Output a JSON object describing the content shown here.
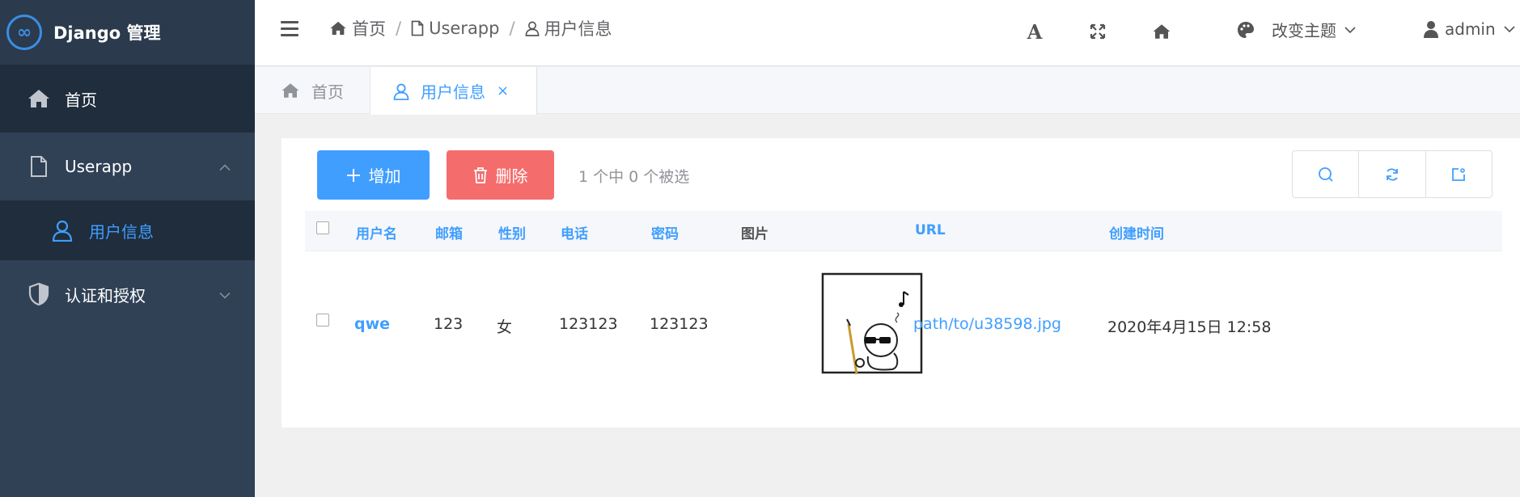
{
  "app": {
    "title": "Django 管理",
    "logo_glyph": "∞"
  },
  "sidebar": {
    "items": [
      {
        "label": "首页",
        "icon": "home-icon"
      },
      {
        "label": "Userapp",
        "icon": "file-icon",
        "expanded": true,
        "children": [
          {
            "label": "用户信息",
            "icon": "user-icon"
          }
        ]
      },
      {
        "label": "认证和授权",
        "icon": "shield-icon",
        "expanded": false
      }
    ]
  },
  "header": {
    "breadcrumb": [
      "首页",
      "Userapp",
      "用户信息"
    ],
    "breadcrumb_sep": "/",
    "font_tool_label": "A",
    "theme_label": "改变主题",
    "user_label": "admin"
  },
  "tabs": [
    {
      "label": "首页",
      "icon": "home-icon",
      "active": false
    },
    {
      "label": "用户信息",
      "icon": "user-icon",
      "active": true,
      "close": "×"
    }
  ],
  "toolbar": {
    "add_label": "增加",
    "delete_label": "删除",
    "selection_info": "1 个中 0 个被选"
  },
  "table": {
    "columns": [
      "用户名",
      "邮箱",
      "性别",
      "电话",
      "密码",
      "图片",
      "URL",
      "创建时间"
    ],
    "rows": [
      {
        "username": "qwe",
        "email": "123",
        "gender": "女",
        "phone": "123123",
        "password": "123123",
        "url": "path/to/u38598.jpg",
        "created": "2020年4月15日 12:58"
      }
    ]
  },
  "colors": {
    "sidebar": "#304156",
    "accent": "#409eff",
    "danger": "#f56c6c"
  }
}
